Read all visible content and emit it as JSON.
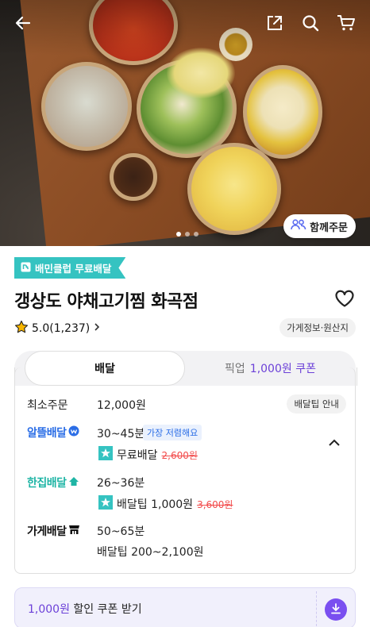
{
  "hero": {
    "group_order_label": "함께주문",
    "carousel_count": 3,
    "carousel_active_index": 0
  },
  "store": {
    "badge_label": "배민클럽 무료배달",
    "name": "갱상도 야채고기찜 화곡점",
    "rating": "5.0",
    "review_count": "(1,237)",
    "info_button_label": "가게정보·원산지"
  },
  "tabs": {
    "delivery_label": "배달",
    "pickup_label": "픽업",
    "pickup_coupon": "1,000원 쿠폰"
  },
  "delivery": {
    "min_order_label": "최소주문",
    "min_order_value": "12,000원",
    "tip_info_label": "배달팁 안내",
    "options": [
      {
        "name": "알뜰배달",
        "time": "30~45분",
        "tag": "가장 저렴해요",
        "fee_label": "무료배달",
        "original_fee": "2,600원"
      },
      {
        "name": "한집배달",
        "time": "26~36분",
        "fee_label": "배달팁 1,000원",
        "original_fee": "3,600원"
      },
      {
        "name": "가게배달",
        "time": "50~65분",
        "fee_label": "배달팁 200~2,100원"
      }
    ]
  },
  "coupon": {
    "amount": "1,000원",
    "text": " 할인 쿠폰 받기"
  },
  "colors": {
    "accent_mint": "#35c3c1",
    "accent_purple": "#6c41d8",
    "price_strike": "#f24a4a",
    "option_blue": "#2a6de6"
  }
}
